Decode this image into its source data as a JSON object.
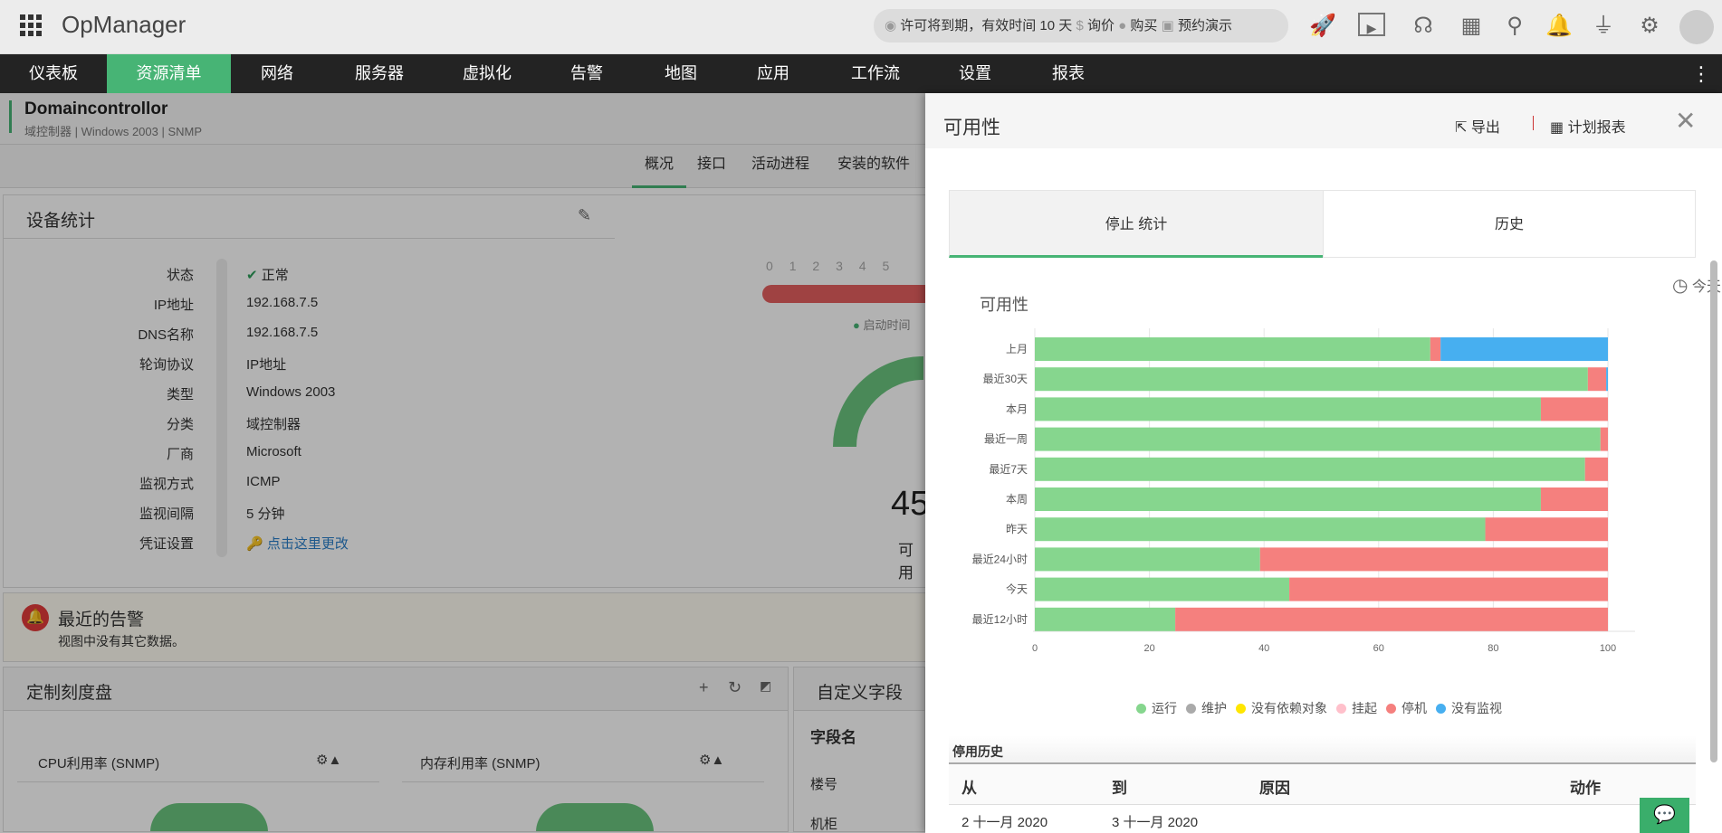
{
  "app": {
    "title": "OpManager",
    "license_text": "许可将到期，有效时间 10 天",
    "price": "询价",
    "buy": "购买",
    "demo": "预约演示"
  },
  "nav": [
    "仪表板",
    "资源清单",
    "网络",
    "服务器",
    "虚拟化",
    "告警",
    "地图",
    "应用",
    "工作流",
    "设置",
    "报表"
  ],
  "device": {
    "name": "Domaincontrollor",
    "subtitle": "域控制器 | Windows 2003 | SNMP",
    "tabs": [
      "概况",
      "接口",
      "活动进程",
      "安装的软件"
    ],
    "card_title": "设备统计",
    "rows": [
      {
        "label": "状态",
        "value": "正常"
      },
      {
        "label": "IP地址",
        "value": "192.168.7.5"
      },
      {
        "label": "DNS名称",
        "value": "192.168.7.5"
      },
      {
        "label": "轮询协议",
        "value": "IP地址"
      },
      {
        "label": "类型",
        "value": "Windows 2003"
      },
      {
        "label": "分类",
        "value": "域控制器"
      },
      {
        "label": "厂商",
        "value": "Microsoft"
      },
      {
        "label": "监视方式",
        "value": "ICMP"
      },
      {
        "label": "监视间隔",
        "value": "5 分钟"
      },
      {
        "label": "凭证设置",
        "value": "点击这里更改"
      }
    ],
    "scale": [
      "0",
      "1",
      "2",
      "3",
      "4",
      "5"
    ],
    "uptime_label": "启动时间",
    "gauge_value": "45",
    "gauge_label": "可用"
  },
  "alerts": {
    "title": "最近的告警",
    "empty": "视图中没有其它数据。"
  },
  "dials": {
    "title": "定制刻度盘",
    "cpu": "CPU利用率 (SNMP)",
    "mem": "内存利用率 (SNMP)"
  },
  "custom": {
    "title": "自定义字段",
    "col": "字段名",
    "rows": [
      "楼号",
      "机柜"
    ]
  },
  "panel": {
    "title": "可用性",
    "export": "导出",
    "schedule": "计划报表",
    "tabs": [
      "停止 统计",
      "历史"
    ],
    "period": "今天",
    "history": {
      "title": "停用历史",
      "cols": [
        "从",
        "到",
        "原因",
        "动作"
      ],
      "rows": [
        [
          "2 十一月 2020",
          "3 十一月 2020",
          "",
          ""
        ]
      ]
    }
  },
  "chart_data": {
    "type": "bar",
    "orientation": "horizontal",
    "stacked": true,
    "title": "可用性",
    "categories": [
      "上月",
      "最近30天",
      "本月",
      "最近一周",
      "最近7天",
      "本周",
      "昨天",
      "最近24小时",
      "今天",
      "最近12小时"
    ],
    "xlim": [
      0,
      100
    ],
    "xticks": [
      "0",
      "20",
      "40",
      "60",
      "80",
      "100"
    ],
    "legend_position": "bottom",
    "series": [
      {
        "name": "运行",
        "color": "#86d68e",
        "values": [
          69,
          96.5,
          88.3,
          98.7,
          96,
          88.3,
          78.6,
          39.3,
          44.4,
          24.5
        ]
      },
      {
        "name": "维护",
        "color": "#aaaaaa",
        "values": [
          0,
          0,
          0,
          0,
          0,
          0,
          0,
          0,
          0,
          0
        ]
      },
      {
        "name": "没有依赖对象",
        "color": "#ffe600",
        "values": [
          0,
          0,
          0,
          0,
          0,
          0,
          0,
          0,
          0,
          0
        ]
      },
      {
        "name": "挂起",
        "color": "#ffc0cb",
        "values": [
          0,
          0,
          0,
          0,
          0,
          0,
          0,
          0,
          0,
          0
        ]
      },
      {
        "name": "停机",
        "color": "#f5807e",
        "values": [
          1.8,
          3.2,
          11.7,
          1.3,
          4,
          11.7,
          21.4,
          60.7,
          55.6,
          75.5
        ]
      },
      {
        "name": "没有监视",
        "color": "#47aff0",
        "values": [
          29.2,
          0.3,
          0,
          0,
          0,
          0,
          0,
          0,
          0,
          0
        ]
      }
    ]
  }
}
